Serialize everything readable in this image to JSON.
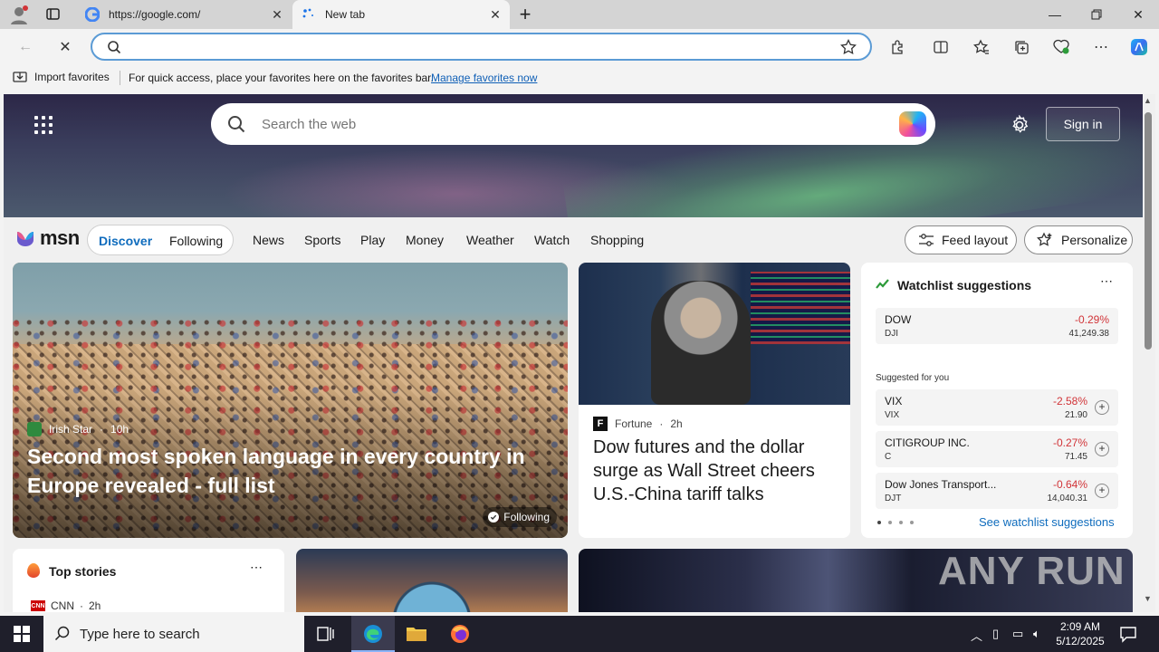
{
  "browser": {
    "tabs": [
      {
        "title": "https://google.com/",
        "active": false
      },
      {
        "title": "New tab",
        "active": true
      }
    ],
    "address": {
      "value": "",
      "placeholder": ""
    },
    "favorites_bar": {
      "import_label": "Import favorites",
      "message": "For quick access, place your favorites here on the favorites bar.",
      "manage_link": "Manage favorites now"
    }
  },
  "msn": {
    "search_placeholder": "Search the web",
    "sign_in": "Sign in",
    "logo_text": "msn",
    "pill": {
      "discover": "Discover",
      "following": "Following"
    },
    "nav": [
      "News",
      "Sports",
      "Play",
      "Money",
      "Weather",
      "Watch",
      "Shopping"
    ],
    "feed_layout": "Feed layout",
    "personalize": "Personalize",
    "main_story": {
      "source": "Irish Star",
      "age": "10h",
      "headline": "Second most spoken language in every country in Europe revealed - full list",
      "following": "Following"
    },
    "fortune_story": {
      "source": "Fortune",
      "age": "2h",
      "headline": "Dow futures and the dollar surge as Wall Street cheers U.S.-China tariff talks"
    },
    "watchlist": {
      "title": "Watchlist suggestions",
      "main": {
        "name": "DOW",
        "symbol": "DJI",
        "change": "-0.29%",
        "price": "41,249.38"
      },
      "suggested_label": "Suggested for you",
      "suggestions": [
        {
          "name": "VIX",
          "symbol": "VIX",
          "change": "-2.58%",
          "price": "21.90"
        },
        {
          "name": "CITIGROUP INC.",
          "symbol": "C",
          "change": "-0.27%",
          "price": "71.45"
        },
        {
          "name": "Dow Jones Transport...",
          "symbol": "DJT",
          "change": "-0.64%",
          "price": "14,040.31"
        }
      ],
      "see_more": "See watchlist suggestions"
    },
    "top_stories": {
      "title": "Top stories",
      "source": "CNN",
      "age": "2h"
    },
    "watermark": "ANY RUN"
  },
  "taskbar": {
    "search_placeholder": "Type here to search",
    "time": "2:09 AM",
    "date": "5/12/2025"
  },
  "colors": {
    "accent": "#0f6cbd",
    "negative": "#d13438",
    "taskbar": "#1f1f2b"
  }
}
